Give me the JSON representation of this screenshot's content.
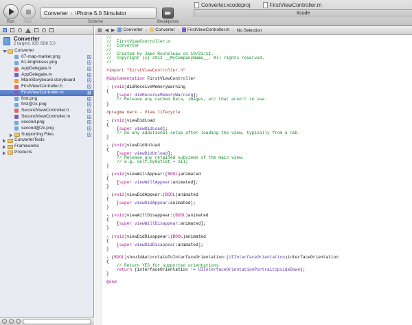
{
  "toolbar": {
    "run_label": "Run",
    "stop_label": "Stop",
    "scheme_name": "Converter",
    "scheme_sep": "›",
    "scheme_destination": "iPhone 5.0 Simulator",
    "scheme_label": "Scheme",
    "breakpoints_label": "Breakpoints",
    "window_tabs": [
      "Converter.xcodeproj",
      "FirstViewController.m"
    ],
    "xcode_tab": "Xcode"
  },
  "sidebar": {
    "project": {
      "name": "Converter",
      "subtitle": "2 targets, iOS SDK 5.0"
    },
    "items": [
      {
        "name": "Converter",
        "kind": "folder",
        "indent": 1,
        "open": true,
        "badge": ""
      },
      {
        "name": "07-map-marker.png",
        "kind": "png",
        "indent": 2,
        "badge": "A"
      },
      {
        "name": "61-brightness.png",
        "kind": "png",
        "indent": 2,
        "badge": "A"
      },
      {
        "name": "AppDelegate.h",
        "kind": "h",
        "indent": 2,
        "badge": "A"
      },
      {
        "name": "AppDelegate.m",
        "kind": "m",
        "indent": 2,
        "badge": "A"
      },
      {
        "name": "MainStoryboard.storyboard",
        "kind": "sb",
        "indent": 2,
        "badge": "A"
      },
      {
        "name": "FirstViewController.h",
        "kind": "h",
        "indent": 2,
        "badge": "A"
      },
      {
        "name": "FirstViewController.m",
        "kind": "m",
        "indent": 2,
        "badge": "A",
        "selected": true
      },
      {
        "name": "first.png",
        "kind": "png",
        "indent": 2,
        "badge": "A"
      },
      {
        "name": "first@2x.png",
        "kind": "png",
        "indent": 2,
        "badge": "A"
      },
      {
        "name": "SecondViewController.h",
        "kind": "h",
        "indent": 2,
        "badge": "A"
      },
      {
        "name": "SecondViewController.m",
        "kind": "m",
        "indent": 2,
        "badge": "A"
      },
      {
        "name": "second.png",
        "kind": "png",
        "indent": 2,
        "badge": "A"
      },
      {
        "name": "second@2x.png",
        "kind": "png",
        "indent": 2,
        "badge": "A"
      },
      {
        "name": "Supporting Files",
        "kind": "folder",
        "indent": 2,
        "open": false,
        "badge": "A"
      },
      {
        "name": "ConverterTests",
        "kind": "folder",
        "indent": 1,
        "open": false,
        "badge": ""
      },
      {
        "name": "Frameworks",
        "kind": "folder",
        "indent": 1,
        "open": false,
        "badge": ""
      },
      {
        "name": "Products",
        "kind": "folder",
        "indent": 1,
        "open": false,
        "badge": ""
      }
    ]
  },
  "jumpbar": {
    "crumbs": [
      "Converter",
      "Converter",
      "FirstViewController.m",
      "No Selection"
    ]
  },
  "colors": {
    "comment": "#0a8a1e",
    "preprocessor": "#7c3a2a",
    "keyword": "#b00d8f",
    "string": "#c4251e",
    "class": "#5b2ea6",
    "selection": "#4a72c0"
  },
  "code_lines": [
    [
      [
        "//",
        "c-comment"
      ]
    ],
    [
      [
        "//  FirstViewController.m",
        "c-comment"
      ]
    ],
    [
      [
        "//  Converter",
        "c-comment"
      ]
    ],
    [
      [
        "//",
        "c-comment"
      ]
    ],
    [
      [
        "//  Created by Jake Rocheleau on 10/23/11.",
        "c-comment"
      ]
    ],
    [
      [
        "//  Copyright (c) 2011 __MyCompanyName__. All rights reserved.",
        "c-comment"
      ]
    ],
    [
      [
        "//",
        "c-comment"
      ]
    ],
    [],
    [
      [
        "#import ",
        "c-pre"
      ],
      [
        "\"FirstViewController.h\"",
        "c-str"
      ]
    ],
    [],
    [
      [
        "@implementation ",
        "c-kw"
      ],
      [
        "FirstViewController",
        "c-plain"
      ]
    ],
    [],
    [
      [
        "- (",
        "c-plain"
      ],
      [
        "void",
        "c-kw"
      ],
      [
        ")didReceiveMemoryWarning",
        "c-plain"
      ]
    ],
    [
      [
        "{",
        "c-plain"
      ]
    ],
    [
      [
        "    [",
        "c-plain"
      ],
      [
        "super ",
        "c-kw"
      ],
      [
        "didReceiveMemoryWarning",
        "c-cls"
      ],
      [
        "];",
        "c-plain"
      ]
    ],
    [
      [
        "    // Release any cached data, images, etc that aren't in use.",
        "c-comment"
      ]
    ],
    [
      [
        "}",
        "c-plain"
      ]
    ],
    [],
    [
      [
        "#pragma mark - View lifecycle",
        "c-pre"
      ]
    ],
    [],
    [
      [
        "- (",
        "c-plain"
      ],
      [
        "void",
        "c-kw"
      ],
      [
        ")viewDidLoad",
        "c-plain"
      ]
    ],
    [
      [
        "{",
        "c-plain"
      ]
    ],
    [
      [
        "    [",
        "c-plain"
      ],
      [
        "super ",
        "c-kw"
      ],
      [
        "viewDidLoad",
        "c-cls"
      ],
      [
        "];",
        "c-plain"
      ]
    ],
    [
      [
        "    // Do any additional setup after loading the view, typically from a nib.",
        "c-comment"
      ]
    ],
    [
      [
        "}",
        "c-plain"
      ]
    ],
    [],
    [
      [
        "- (",
        "c-plain"
      ],
      [
        "void",
        "c-kw"
      ],
      [
        ")viewDidUnload",
        "c-plain"
      ]
    ],
    [
      [
        "{",
        "c-plain"
      ]
    ],
    [
      [
        "    [",
        "c-plain"
      ],
      [
        "super ",
        "c-kw"
      ],
      [
        "viewDidUnload",
        "c-cls"
      ],
      [
        "];",
        "c-plain"
      ]
    ],
    [
      [
        "    // Release any retained subviews of the main view.",
        "c-comment"
      ]
    ],
    [
      [
        "    // e.g. self.myOutlet = nil;",
        "c-comment"
      ]
    ],
    [
      [
        "}",
        "c-plain"
      ]
    ],
    [],
    [
      [
        "- (",
        "c-plain"
      ],
      [
        "void",
        "c-kw"
      ],
      [
        ")viewWillAppear:(",
        "c-plain"
      ],
      [
        "BOOL",
        "c-kw"
      ],
      [
        ")animated",
        "c-plain"
      ]
    ],
    [
      [
        "{",
        "c-plain"
      ]
    ],
    [
      [
        "    [",
        "c-plain"
      ],
      [
        "super ",
        "c-kw"
      ],
      [
        "viewWillAppear",
        "c-cls"
      ],
      [
        ":animated];",
        "c-plain"
      ]
    ],
    [
      [
        "}",
        "c-plain"
      ]
    ],
    [],
    [
      [
        "- (",
        "c-plain"
      ],
      [
        "void",
        "c-kw"
      ],
      [
        ")viewDidAppear:(",
        "c-plain"
      ],
      [
        "BOOL",
        "c-kw"
      ],
      [
        ")animated",
        "c-plain"
      ]
    ],
    [
      [
        "{",
        "c-plain"
      ]
    ],
    [
      [
        "    [",
        "c-plain"
      ],
      [
        "super ",
        "c-kw"
      ],
      [
        "viewDidAppear",
        "c-cls"
      ],
      [
        ":animated];",
        "c-plain"
      ]
    ],
    [
      [
        "}",
        "c-plain"
      ]
    ],
    [],
    [
      [
        "- (",
        "c-plain"
      ],
      [
        "void",
        "c-kw"
      ],
      [
        ")viewWillDisappear:(",
        "c-plain"
      ],
      [
        "BOOL",
        "c-kw"
      ],
      [
        ")animated",
        "c-plain"
      ]
    ],
    [
      [
        "{",
        "c-plain"
      ]
    ],
    [
      [
        "    [",
        "c-plain"
      ],
      [
        "super ",
        "c-kw"
      ],
      [
        "viewWillDisappear",
        "c-cls"
      ],
      [
        ":animated];",
        "c-plain"
      ]
    ],
    [
      [
        "}",
        "c-plain"
      ]
    ],
    [],
    [
      [
        "- (",
        "c-plain"
      ],
      [
        "void",
        "c-kw"
      ],
      [
        ")viewDidDisappear:(",
        "c-plain"
      ],
      [
        "BOOL",
        "c-kw"
      ],
      [
        ")animated",
        "c-plain"
      ]
    ],
    [
      [
        "{",
        "c-plain"
      ]
    ],
    [
      [
        "    [",
        "c-plain"
      ],
      [
        "super ",
        "c-kw"
      ],
      [
        "viewDidDisappear",
        "c-cls"
      ],
      [
        ":animated];",
        "c-plain"
      ]
    ],
    [
      [
        "}",
        "c-plain"
      ]
    ],
    [],
    [
      [
        "- (",
        "c-plain"
      ],
      [
        "BOOL",
        "c-kw"
      ],
      [
        ")shouldAutorotateToInterfaceOrientation:(",
        "c-plain"
      ],
      [
        "UIInterfaceOrientation",
        "c-cls"
      ],
      [
        ")interfaceOrientation",
        "c-plain"
      ]
    ],
    [
      [
        "{",
        "c-plain"
      ]
    ],
    [
      [
        "    // Return YES for supported orientations",
        "c-comment"
      ]
    ],
    [
      [
        "    return ",
        "c-kw"
      ],
      [
        "(interfaceOrientation != ",
        "c-plain"
      ],
      [
        "UIInterfaceOrientationPortraitUpsideDown",
        "c-cls"
      ],
      [
        ");",
        "c-plain"
      ]
    ],
    [
      [
        "}",
        "c-plain"
      ]
    ],
    [],
    [
      [
        "@end",
        "c-kw"
      ]
    ]
  ]
}
